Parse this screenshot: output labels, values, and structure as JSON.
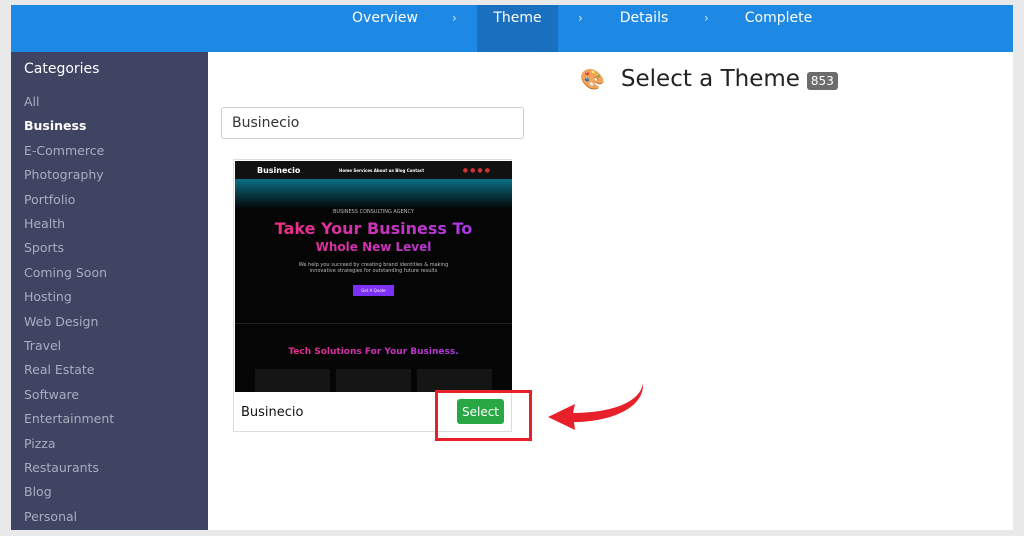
{
  "nav": {
    "steps": [
      "Overview",
      "Theme",
      "Details",
      "Complete"
    ],
    "separator": "›",
    "active": "Theme"
  },
  "sidebar": {
    "title": "Categories",
    "items": [
      "All",
      "Business",
      "E-Commerce",
      "Photography",
      "Portfolio",
      "Health",
      "Sports",
      "Coming Soon",
      "Hosting",
      "Web Design",
      "Travel",
      "Real Estate",
      "Software",
      "Entertainment",
      "Pizza",
      "Restaurants",
      "Blog",
      "Personal"
    ],
    "active": "Business"
  },
  "main": {
    "title": "Select a Theme",
    "count": "853",
    "search_value": "Businecio",
    "icon": "palette-icon"
  },
  "card": {
    "name": "Businecio",
    "select_label": "Select",
    "preview": {
      "logo": "Businecio",
      "menu": "Home  Services  About us  Blog  Contact",
      "eyebrow": "BUSINESS CONSULTING AGENCY",
      "headline1": "Take Your Business To",
      "headline2": "Whole New Level",
      "text": "We help you succeed by creating brand identities & making innovative strategies for outstanding future results",
      "button": "Get A Quote",
      "section": "Tech Solutions For Your Business."
    }
  },
  "colors": {
    "nav": "#1e88e5",
    "sidebar": "#3f4462",
    "select": "#28a745",
    "highlight": "#e8202a"
  }
}
